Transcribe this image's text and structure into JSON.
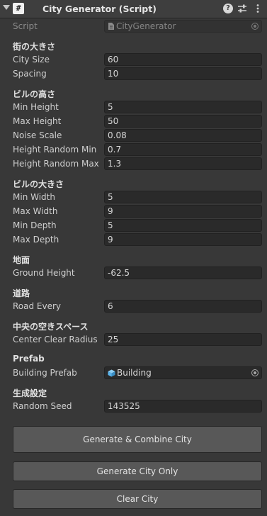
{
  "component": {
    "title": "City Generator (Script)",
    "icon_glyph": "#"
  },
  "script_field": {
    "label": "Script",
    "value": "CityGenerator"
  },
  "sections": {
    "city": "街の大きさ",
    "height": "ビルの高さ",
    "size": "ビルの大きさ",
    "ground": "地面",
    "road": "道路",
    "clear": "中央の空きスペース",
    "prefab": "Prefab",
    "gen": "生成設定"
  },
  "fields": {
    "city_size": {
      "label": "City Size",
      "value": "60"
    },
    "spacing": {
      "label": "Spacing",
      "value": "10"
    },
    "min_height": {
      "label": "Min Height",
      "value": "5"
    },
    "max_height": {
      "label": "Max Height",
      "value": "50"
    },
    "noise_scale": {
      "label": "Noise Scale",
      "value": "0.08"
    },
    "height_random_min": {
      "label": "Height Random Min",
      "value": "0.7"
    },
    "height_random_max": {
      "label": "Height Random Max",
      "value": "1.3"
    },
    "min_width": {
      "label": "Min Width",
      "value": "5"
    },
    "max_width": {
      "label": "Max Width",
      "value": "9"
    },
    "min_depth": {
      "label": "Min Depth",
      "value": "5"
    },
    "max_depth": {
      "label": "Max Depth",
      "value": "9"
    },
    "ground_height": {
      "label": "Ground Height",
      "value": "-62.5"
    },
    "road_every": {
      "label": "Road Every",
      "value": "6"
    },
    "center_clear_radius": {
      "label": "Center Clear Radius",
      "value": "25"
    },
    "building_prefab": {
      "label": "Building Prefab",
      "value": "Building"
    },
    "random_seed": {
      "label": "Random Seed",
      "value": "143525"
    }
  },
  "buttons": {
    "generate_combine": "Generate & Combine City",
    "generate_only": "Generate City Only",
    "clear": "Clear City"
  },
  "icons": {
    "fold": "triangle-down",
    "script": "csharp-script-icon",
    "help": "question-mark",
    "preset": "sliders",
    "menu": "vertical-dots",
    "script_asset": "document-icon",
    "prefab": "cube-prefab-icon",
    "object_picker": "circle-dot"
  },
  "colors": {
    "prefab_icon": "#5ab4ec"
  }
}
